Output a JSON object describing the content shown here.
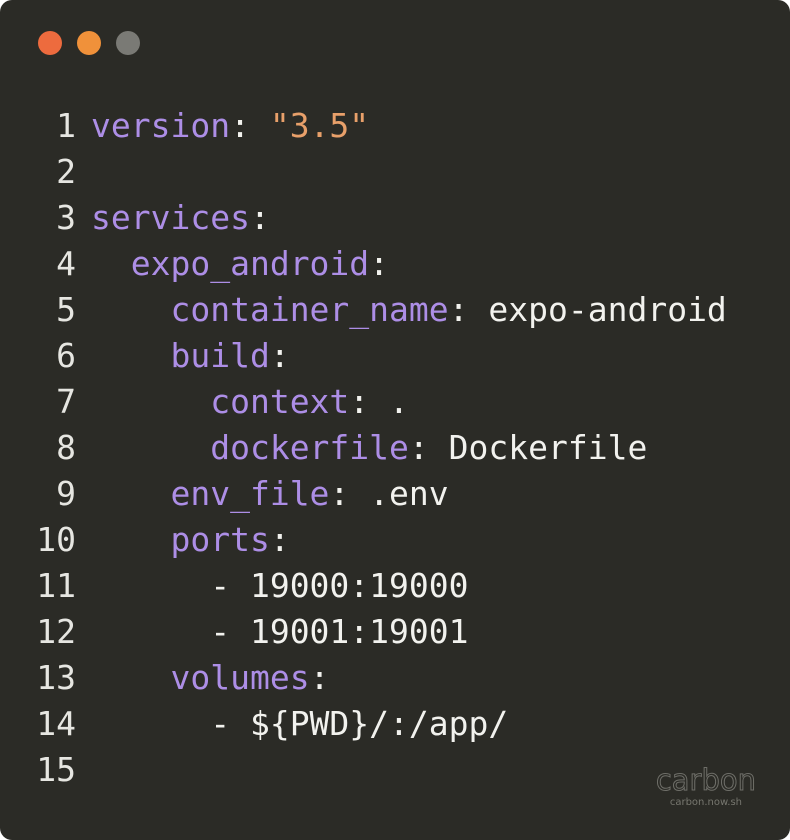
{
  "window": {
    "traffic_lights": [
      {
        "name": "close",
        "color": "#ed6b3e"
      },
      {
        "name": "minimize",
        "color": "#f0913a"
      },
      {
        "name": "maximize",
        "color": "#7a7a75"
      }
    ],
    "colors": {
      "background": "#2b2b26",
      "key": "#ad8ee6",
      "string": "#e8a06a",
      "text": "#f2f2ee"
    }
  },
  "code": {
    "lines": [
      {
        "n": "1",
        "indent": "",
        "key": "version",
        "punct": ": ",
        "string": "\"3.5\"",
        "value": ""
      },
      {
        "n": "2",
        "indent": "",
        "key": "",
        "punct": "",
        "string": "",
        "value": ""
      },
      {
        "n": "3",
        "indent": "",
        "key": "services",
        "punct": ":",
        "string": "",
        "value": ""
      },
      {
        "n": "4",
        "indent": "  ",
        "key": "expo_android",
        "punct": ":",
        "string": "",
        "value": ""
      },
      {
        "n": "5",
        "indent": "    ",
        "key": "container_name",
        "punct": ": ",
        "string": "",
        "value": "expo-android"
      },
      {
        "n": "6",
        "indent": "    ",
        "key": "build",
        "punct": ":",
        "string": "",
        "value": ""
      },
      {
        "n": "7",
        "indent": "      ",
        "key": "context",
        "punct": ": ",
        "string": "",
        "value": "."
      },
      {
        "n": "8",
        "indent": "      ",
        "key": "dockerfile",
        "punct": ": ",
        "string": "",
        "value": "Dockerfile"
      },
      {
        "n": "9",
        "indent": "    ",
        "key": "env_file",
        "punct": ": ",
        "string": "",
        "value": ".env"
      },
      {
        "n": "10",
        "indent": "    ",
        "key": "ports",
        "punct": ":",
        "string": "",
        "value": ""
      },
      {
        "n": "11",
        "indent": "      ",
        "key": "",
        "punct": "",
        "string": "",
        "value": "- 19000:19000"
      },
      {
        "n": "12",
        "indent": "      ",
        "key": "",
        "punct": "",
        "string": "",
        "value": "- 19001:19001"
      },
      {
        "n": "13",
        "indent": "    ",
        "key": "volumes",
        "punct": ":",
        "string": "",
        "value": ""
      },
      {
        "n": "14",
        "indent": "      ",
        "key": "",
        "punct": "",
        "string": "",
        "value": "- ${PWD}/:/app/"
      },
      {
        "n": "15",
        "indent": "",
        "key": "",
        "punct": "",
        "string": "",
        "value": ""
      }
    ]
  },
  "watermark": {
    "logo": "carbon",
    "url": "carbon.now.sh"
  }
}
